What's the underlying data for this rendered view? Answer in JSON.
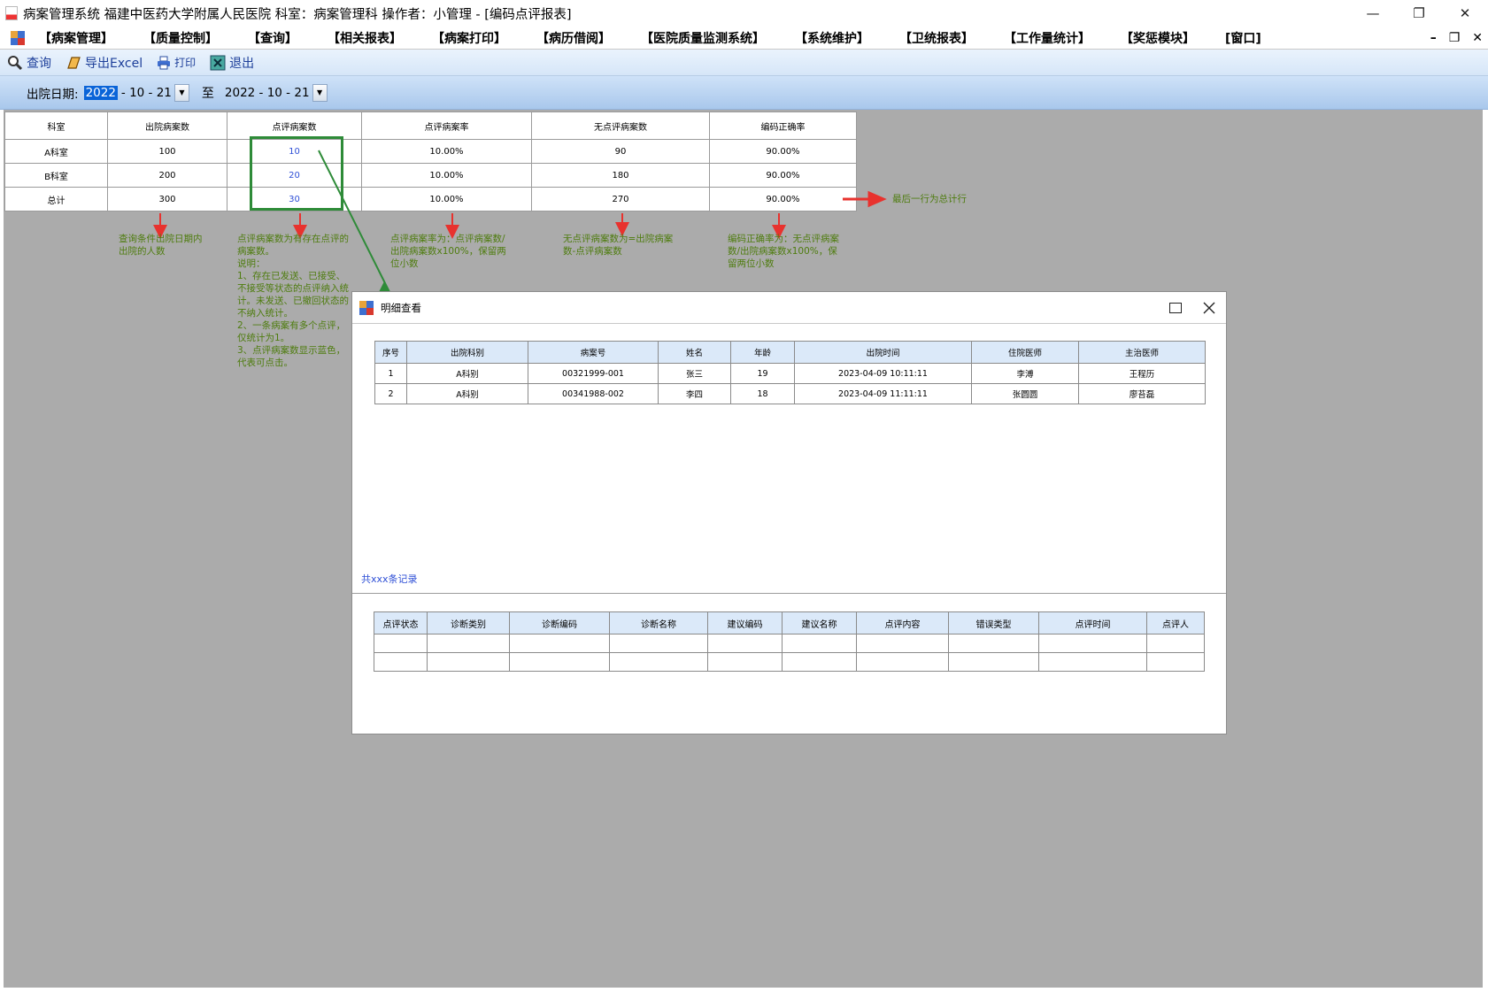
{
  "window": {
    "title": "病案管理系统  福建中医药大学附属人民医院  科室：病案管理科 操作者：小管理 - [编码点评报表]",
    "minimize": "—",
    "restore": "❐",
    "close": "✕"
  },
  "menu": {
    "items": [
      "【病案管理】",
      "【质量控制】",
      "【查询】",
      "【相关报表】",
      "【病案打印】",
      "【病历借阅】",
      "【医院质量监测系统】",
      "【系统维护】",
      "【卫统报表】",
      "【工作量统计】",
      "【奖惩模块】",
      "[窗口]"
    ],
    "mdi_min": "–",
    "mdi_restore": "❐",
    "mdi_close": "✕"
  },
  "toolbar": {
    "query": "查询",
    "export": "导出Excel",
    "print": "打印",
    "exit": "退出"
  },
  "filter": {
    "label": "出院日期:",
    "from_year": "2022",
    "from_rest": "- 10 - 21",
    "to_label": "至",
    "to_date": "2022 - 10 - 21"
  },
  "report": {
    "headers": [
      "科室",
      "出院病案数",
      "点评病案数",
      "点评病案率",
      "无点评病案数",
      "编码正确率"
    ],
    "rows": [
      [
        "A科室",
        "100",
        "10",
        "10.00%",
        "90",
        "90.00%"
      ],
      [
        "B科室",
        "200",
        "20",
        "10.00%",
        "180",
        "90.00%"
      ],
      [
        "总计",
        "300",
        "30",
        "10.00%",
        "270",
        "90.00%"
      ]
    ]
  },
  "notes": {
    "discharged": "查询条件出院日期内出院的人数",
    "reviewed": "点评病案数为有存在点评的病案数。\n说明：\n1、存在已发送、已接受、不接受等状态的点评纳入统计。未发送、已撤回状态的不纳入统计。\n2、一条病案有多个点评，仅统计为1。\n3、点评病案数显示蓝色，代表可点击。",
    "rate": "点评病案率为：点评病案数/出院病案数x100%，保留两位小数",
    "unreviewed": "无点评病案数为=出院病案数-点评病案数",
    "accuracy": "编码正确率为：无点评病案数/出院病案数x100%，保留两位小数",
    "total_row": "最后一行为总计行"
  },
  "dialog": {
    "title": "明细查看",
    "detail_headers": [
      "序号",
      "出院科别",
      "病案号",
      "姓名",
      "年龄",
      "出院时间",
      "住院医师",
      "主治医师"
    ],
    "detail_rows": [
      [
        "1",
        "A科别",
        "00321999-001",
        "张三",
        "19",
        "2023-04-09 10:11:11",
        "李溥",
        "王程历"
      ],
      [
        "2",
        "A科别",
        "00341988-002",
        "李四",
        "18",
        "2023-04-09 11:11:11",
        "张圆圆",
        "廖苔磊"
      ]
    ],
    "record_count": "共xxx条记录",
    "review_headers": [
      "点评状态",
      "诊断类别",
      "诊断编码",
      "诊断名称",
      "建议编码",
      "建议名称",
      "点评内容",
      "错误类型",
      "点评时间",
      "点评人"
    ]
  },
  "colors": {
    "link_blue": "#2e4fd6",
    "note_green": "#4e7c0e",
    "arrow_red": "#e8322e",
    "highlight_green": "#2e8b38"
  }
}
